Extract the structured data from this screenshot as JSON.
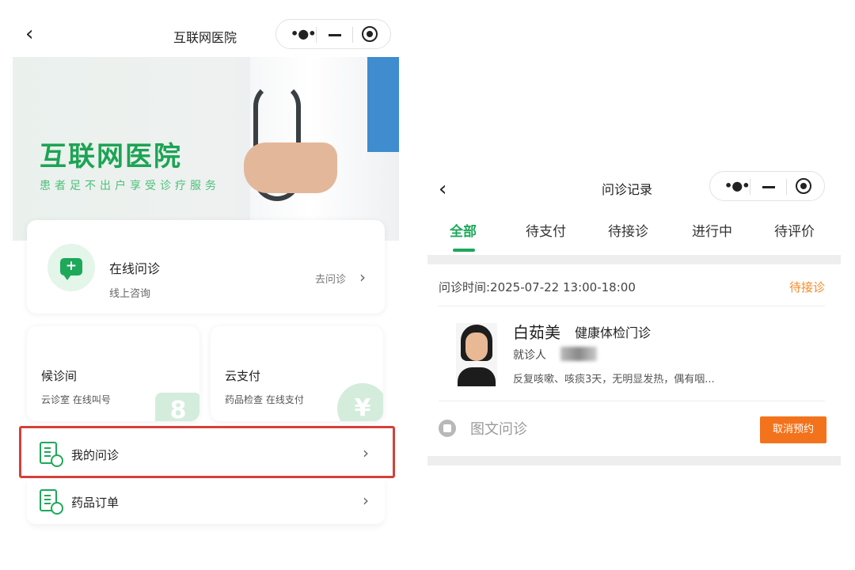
{
  "left": {
    "nav_title": "互联网医院",
    "banner": {
      "title": "互联网医院",
      "subtitle": "患者足不出户享受诊疗服务"
    },
    "consult_card": {
      "title": "在线问诊",
      "subtitle": "线上咨询",
      "link": "去问诊"
    },
    "cards": [
      {
        "title": "候诊间",
        "subtitle": "云诊室 在线叫号",
        "deco": "8"
      },
      {
        "title": "云支付",
        "subtitle": "药品检查 在线支付",
        "deco": "¥"
      }
    ],
    "rows": [
      {
        "label": "我的问诊"
      },
      {
        "label": "药品订单"
      }
    ]
  },
  "right": {
    "nav_title": "问诊记录",
    "tabs": [
      "全部",
      "待支付",
      "待接诊",
      "进行中",
      "待评价"
    ],
    "active_tab": "全部",
    "record": {
      "time": "问诊时间:2025-07-22  13:00-18:00",
      "status": "待接诊",
      "patient_name": "白茹美",
      "department": "健康体检门诊",
      "visitor_label": "就诊人",
      "symptom": "反复咳嗽、咳痰3天，无明显发热，偶有咽...",
      "type_label": "图文问诊",
      "cancel_button": "取消预约"
    }
  },
  "colors": {
    "brand_green": "#1ea85a",
    "status_orange": "#f58a2b",
    "cancel_orange": "#f3731c",
    "highlight_red": "#d2413a"
  }
}
